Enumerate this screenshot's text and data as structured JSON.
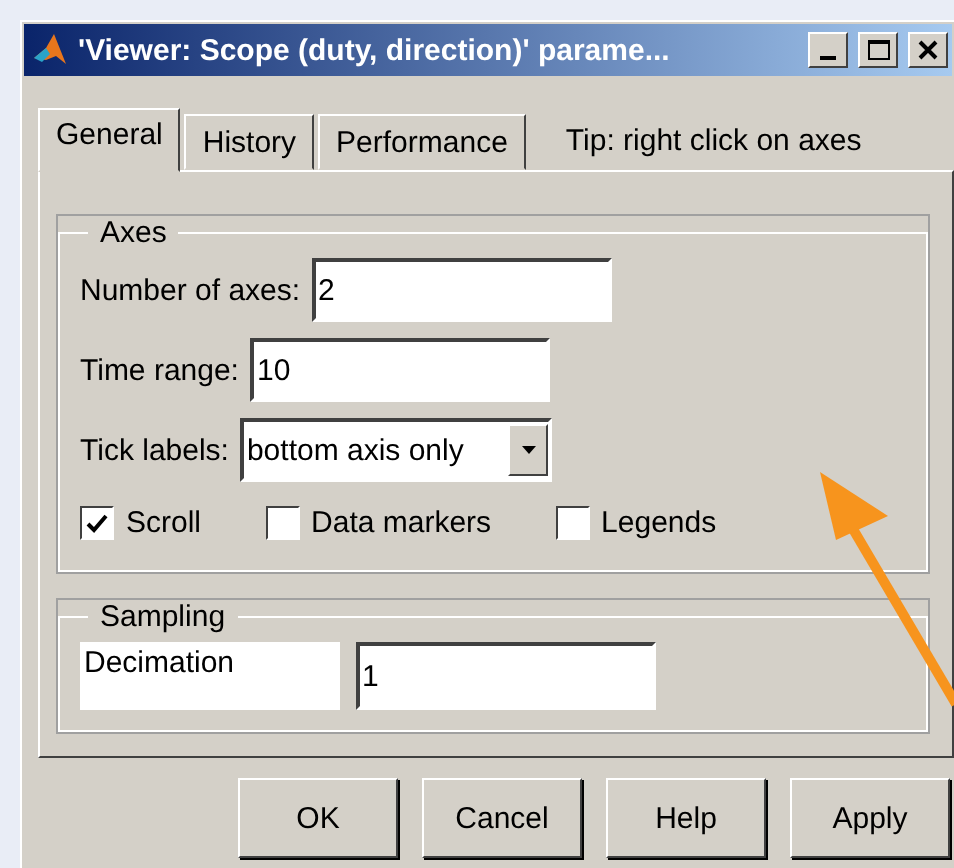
{
  "window": {
    "title": "'Viewer: Scope (duty, direction)' parame..."
  },
  "tabs": [
    {
      "label": "General",
      "selected": true
    },
    {
      "label": "History",
      "selected": false
    },
    {
      "label": "Performance",
      "selected": false
    }
  ],
  "tip": "Tip:  right click on axes",
  "axes": {
    "title": "Axes",
    "fields": [
      {
        "label": "Number of axes:",
        "value": "2"
      },
      {
        "label": "Time range:",
        "value": "10"
      }
    ],
    "tick_labels": {
      "label": "Tick labels:",
      "value": "bottom axis only"
    },
    "checkboxes": [
      {
        "label": "Scroll",
        "checked": true
      },
      {
        "label": "Data markers",
        "checked": false
      },
      {
        "label": "Legends",
        "checked": false
      }
    ]
  },
  "sampling": {
    "title": "Sampling",
    "label": "Decimation",
    "value": "1"
  },
  "buttons": [
    "OK",
    "Cancel",
    "Help",
    "Apply"
  ]
}
